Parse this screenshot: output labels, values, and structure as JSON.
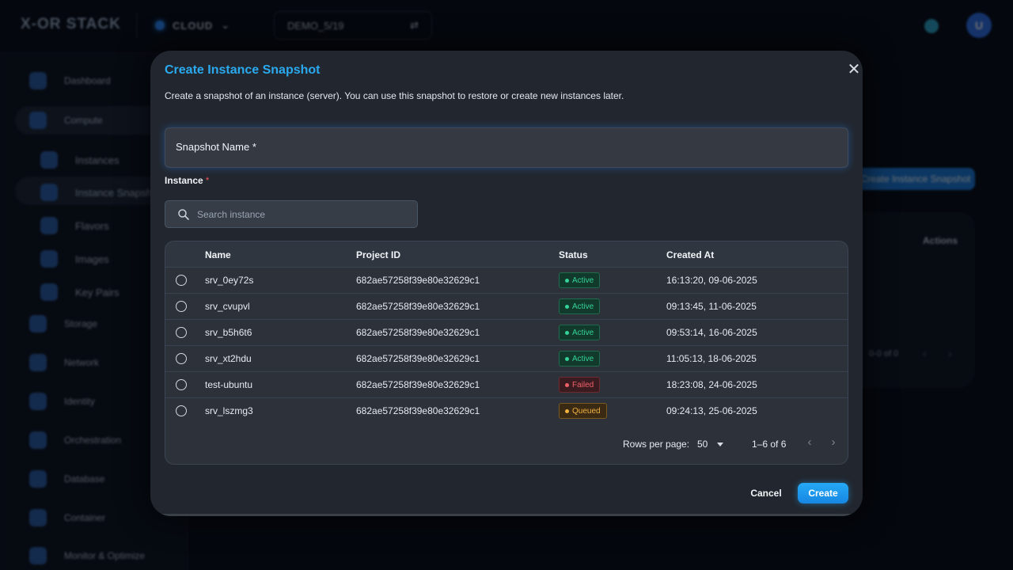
{
  "app": {
    "logo": "X-OR STACK",
    "cloud_label": "CLOUD",
    "project": "DEMO_5/19",
    "avatar_initial": "U"
  },
  "sidebar": {
    "items": [
      {
        "label": "Dashboard"
      },
      {
        "label": "Compute"
      },
      {
        "label": "Instances"
      },
      {
        "label": "Instance Snapshot"
      },
      {
        "label": "Flavors"
      },
      {
        "label": "Images"
      },
      {
        "label": "Key Pairs"
      },
      {
        "label": "Storage"
      },
      {
        "label": "Network"
      },
      {
        "label": "Identity"
      },
      {
        "label": "Orchestration"
      },
      {
        "label": "Database"
      },
      {
        "label": "Container"
      },
      {
        "label": "Monitor & Optimize"
      }
    ]
  },
  "background": {
    "create_button": "Create Instance Snapshot",
    "actions_header": "Actions",
    "pager_range": "0-0 of 0"
  },
  "modal": {
    "title": "Create Instance Snapshot",
    "description": "Create a snapshot of an instance (server). You can use this snapshot to restore or create new instances later.",
    "snapshot_name_label": "Snapshot Name *",
    "instance_label": "Instance",
    "required_mark": "*",
    "search_placeholder": "Search instance",
    "columns": {
      "name": "Name",
      "project": "Project ID",
      "status": "Status",
      "created": "Created At"
    },
    "rows": [
      {
        "name": "srv_0ey72s",
        "project": "682ae57258f39e80e32629c1",
        "status": "Active",
        "created": "16:13:20, 09-06-2025"
      },
      {
        "name": "srv_cvupvl",
        "project": "682ae57258f39e80e32629c1",
        "status": "Active",
        "created": "09:13:45, 11-06-2025"
      },
      {
        "name": "srv_b5h6t6",
        "project": "682ae57258f39e80e32629c1",
        "status": "Active",
        "created": "09:53:14, 16-06-2025"
      },
      {
        "name": "srv_xt2hdu",
        "project": "682ae57258f39e80e32629c1",
        "status": "Active",
        "created": "11:05:13, 18-06-2025"
      },
      {
        "name": "test-ubuntu",
        "project": "682ae57258f39e80e32629c1",
        "status": "Failed",
        "created": "18:23:08, 24-06-2025"
      },
      {
        "name": "srv_lszmg3",
        "project": "682ae57258f39e80e32629c1",
        "status": "Queued",
        "created": "09:24:13, 25-06-2025"
      }
    ],
    "pagination": {
      "rows_label": "Rows per page:",
      "rows_value": "50",
      "range": "1–6 of 6"
    },
    "cancel_label": "Cancel",
    "create_label": "Create"
  },
  "colors": {
    "accent": "#2aa9ef",
    "active": "#34d399",
    "failed": "#f0606a",
    "queued": "#f3b23f"
  }
}
